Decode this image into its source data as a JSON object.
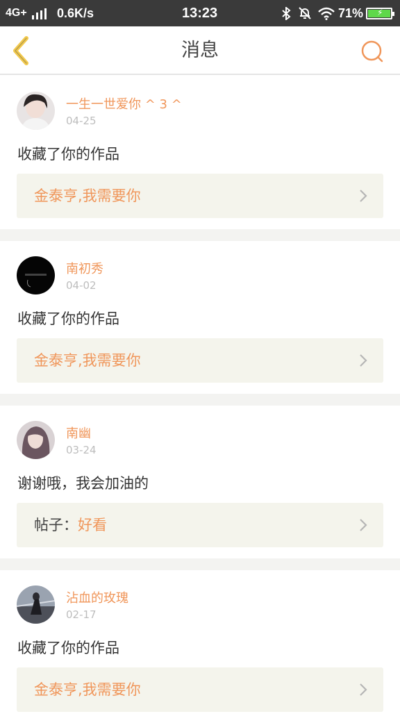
{
  "status_bar": {
    "network": "4G+",
    "speed": "0.6K/s",
    "time": "13:23",
    "battery": "71%"
  },
  "header": {
    "title": "消息",
    "back_icon": "chevron-left-icon",
    "search_icon": "search-icon"
  },
  "colors": {
    "accent": "#f0965a",
    "back_icon": "#f2c94c",
    "ref_box_bg": "#f4f4ec",
    "status_bar_bg": "#3a3a3a"
  },
  "messages": [
    {
      "username": "一生一世爱你 ^ 3 ^",
      "date": "04-25",
      "text": "收藏了你的作品",
      "ref_prefix": "",
      "ref_title": "金泰亨,我需要你"
    },
    {
      "username": "南初秀",
      "date": "04-02",
      "text": "收藏了你的作品",
      "ref_prefix": "",
      "ref_title": "金泰亨,我需要你"
    },
    {
      "username": "南幽",
      "date": "03-24",
      "text": "谢谢哦，我会加油的",
      "ref_prefix": "帖子：",
      "ref_title": "好看"
    },
    {
      "username": "沾血的玫瑰",
      "date": "02-17",
      "text": "收藏了你的作品",
      "ref_prefix": "",
      "ref_title": "金泰亨,我需要你"
    }
  ]
}
